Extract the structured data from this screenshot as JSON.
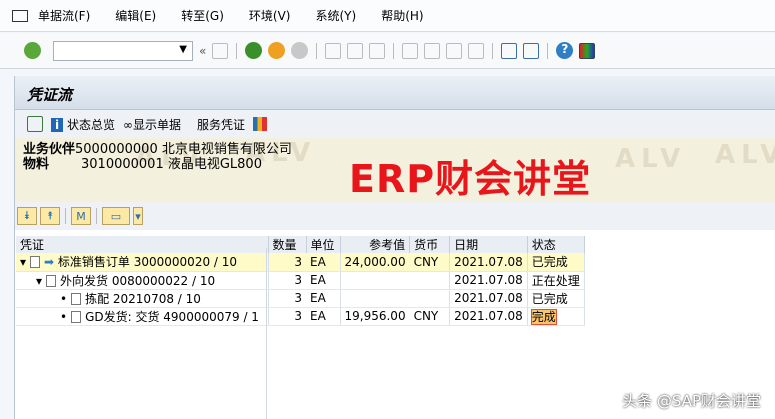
{
  "menu": [
    "单据流(F)",
    "编辑(E)",
    "转至(G)",
    "环境(V)",
    "系统(Y)",
    "帮助(H)"
  ],
  "command_field": {
    "value": ""
  },
  "panel_title": "凭证流",
  "app_toolbar": {
    "status_overview": "状态总览",
    "display_document": "显示单据",
    "service_document": "服务凭证"
  },
  "header": {
    "partner_label": "业务伙伴",
    "partner_value": "5000000000 北京电视销售有限公司",
    "material_label": "物料",
    "material_value": "3010000001 液晶电视GL800",
    "watermark": "ALV"
  },
  "overlay_text": "ERP财会讲堂",
  "table": {
    "columns": [
      "凭证",
      "数量",
      "单位",
      "参考值",
      "货币",
      "日期",
      "状态"
    ],
    "rows": [
      {
        "doc": "标准销售订单 3000000020 / 10",
        "qty": "3",
        "unit": "EA",
        "value": "24,000.00",
        "currency": "CNY",
        "date": "2021.07.08",
        "status": "已完成"
      },
      {
        "doc": "外向发货 0080000022 / 10",
        "qty": "3",
        "unit": "EA",
        "value": "",
        "currency": "",
        "date": "2021.07.08",
        "status": "正在处理"
      },
      {
        "doc": "拣配 20210708 / 10",
        "qty": "3",
        "unit": "EA",
        "value": "",
        "currency": "",
        "date": "2021.07.08",
        "status": "已完成"
      },
      {
        "doc": "GD发货: 交货 4900000079 / 1",
        "qty": "3",
        "unit": "EA",
        "value": "19,956.00",
        "currency": "CNY",
        "date": "2021.07.08",
        "status": "完成"
      }
    ]
  },
  "footer_watermark": "头条 @SAP财会讲堂"
}
